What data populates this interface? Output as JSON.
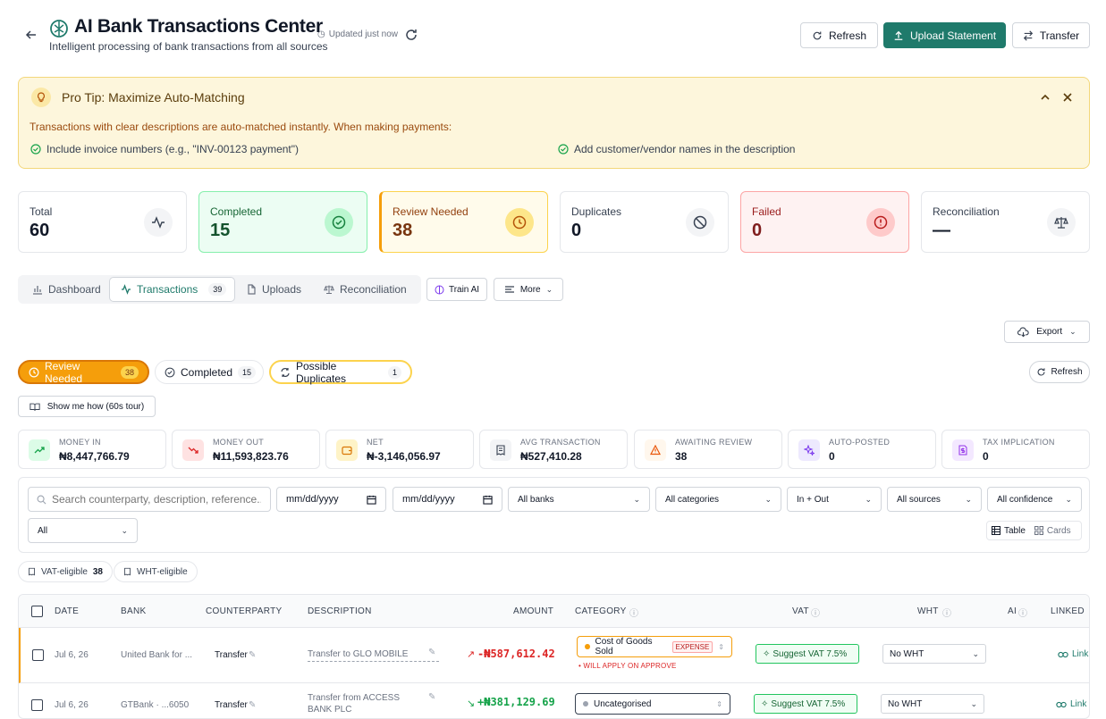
{
  "header": {
    "title": "AI Bank Transactions Center",
    "subtitle": "Intelligent processing of bank transactions from all sources",
    "updated": "Updated just now",
    "refresh_label": "Refresh",
    "upload_label": "Upload Statement",
    "transfer_label": "Transfer"
  },
  "tip": {
    "title": "Pro Tip: Maximize Auto-Matching",
    "text": "Transactions with clear descriptions are auto-matched instantly. When making payments:",
    "items": [
      "Include invoice numbers (e.g., \"INV-00123 payment\")",
      "Add customer/vendor names in the description"
    ]
  },
  "summary": [
    {
      "label": "Total",
      "value": "60"
    },
    {
      "label": "Completed",
      "value": "15"
    },
    {
      "label": "Review Needed",
      "value": "38"
    },
    {
      "label": "Duplicates",
      "value": "0"
    },
    {
      "label": "Failed",
      "value": "0"
    },
    {
      "label": "Reconciliation",
      "value": "—"
    }
  ],
  "tabs": [
    {
      "label": "Dashboard"
    },
    {
      "label": "Transactions",
      "count": "39"
    },
    {
      "label": "Uploads"
    },
    {
      "label": "Reconciliation"
    }
  ],
  "train_label": "Train AI",
  "more_label": "More",
  "export_label": "Export",
  "status_pills": [
    {
      "label": "Review Needed",
      "count": "38"
    },
    {
      "label": "Completed",
      "count": "15"
    },
    {
      "label": "Possible Duplicates",
      "count": "1"
    }
  ],
  "refresh_small": "Refresh",
  "tour_label": "Show me how (60s tour)",
  "stats": [
    {
      "label": "MONEY IN",
      "value": "₦8,447,766.79"
    },
    {
      "label": "MONEY OUT",
      "value": "₦11,593,823.76"
    },
    {
      "label": "NET",
      "value": "₦-3,146,056.97"
    },
    {
      "label": "AVG TRANSACTION",
      "value": "₦527,410.28"
    },
    {
      "label": "AWAITING REVIEW",
      "value": "38"
    },
    {
      "label": "AUTO-POSTED",
      "value": "0"
    },
    {
      "label": "TAX IMPLICATION",
      "value": "0"
    }
  ],
  "filters": {
    "search_placeholder": "Search counterparty, description, reference...",
    "date_from": "mm/dd/yyyy",
    "date_to": "mm/dd/yyyy",
    "bank": "All banks",
    "category": "All categories",
    "direction": "In + Out",
    "source": "All sources",
    "confidence": "All confidence",
    "status": "All",
    "view_table": "Table",
    "view_cards": "Cards"
  },
  "tags": [
    {
      "label": "VAT-eligible",
      "count": "38"
    },
    {
      "label": "WHT-eligible",
      "count": ""
    }
  ],
  "table": {
    "columns": [
      "DATE",
      "BANK",
      "COUNTERPARTY",
      "DESCRIPTION",
      "AMOUNT",
      "CATEGORY",
      "VAT",
      "WHT",
      "AI",
      "LINKED"
    ],
    "rows": [
      {
        "date": "Jul 6, 26",
        "bank": "United Bank for ...",
        "counterparty": "Transfer",
        "description": "Transfer to GLO MOBILE",
        "amount": "-₦587,612.42",
        "category": "Cost of Goods Sold",
        "category_type": "EXPENSE",
        "category_note": "• WILL APPLY ON APPROVE",
        "vat": "Suggest VAT 7.5%",
        "wht": "No WHT",
        "link": "Link"
      },
      {
        "date": "Jul 6, 26",
        "bank": "GTBank · ...6050",
        "counterparty": "Transfer",
        "description": "Transfer from ACCESS BANK PLC",
        "amount": "+₦381,129.69",
        "category": "Uncategorised",
        "vat": "Suggest VAT 7.5%",
        "wht": "No WHT",
        "link": "Link"
      }
    ]
  }
}
